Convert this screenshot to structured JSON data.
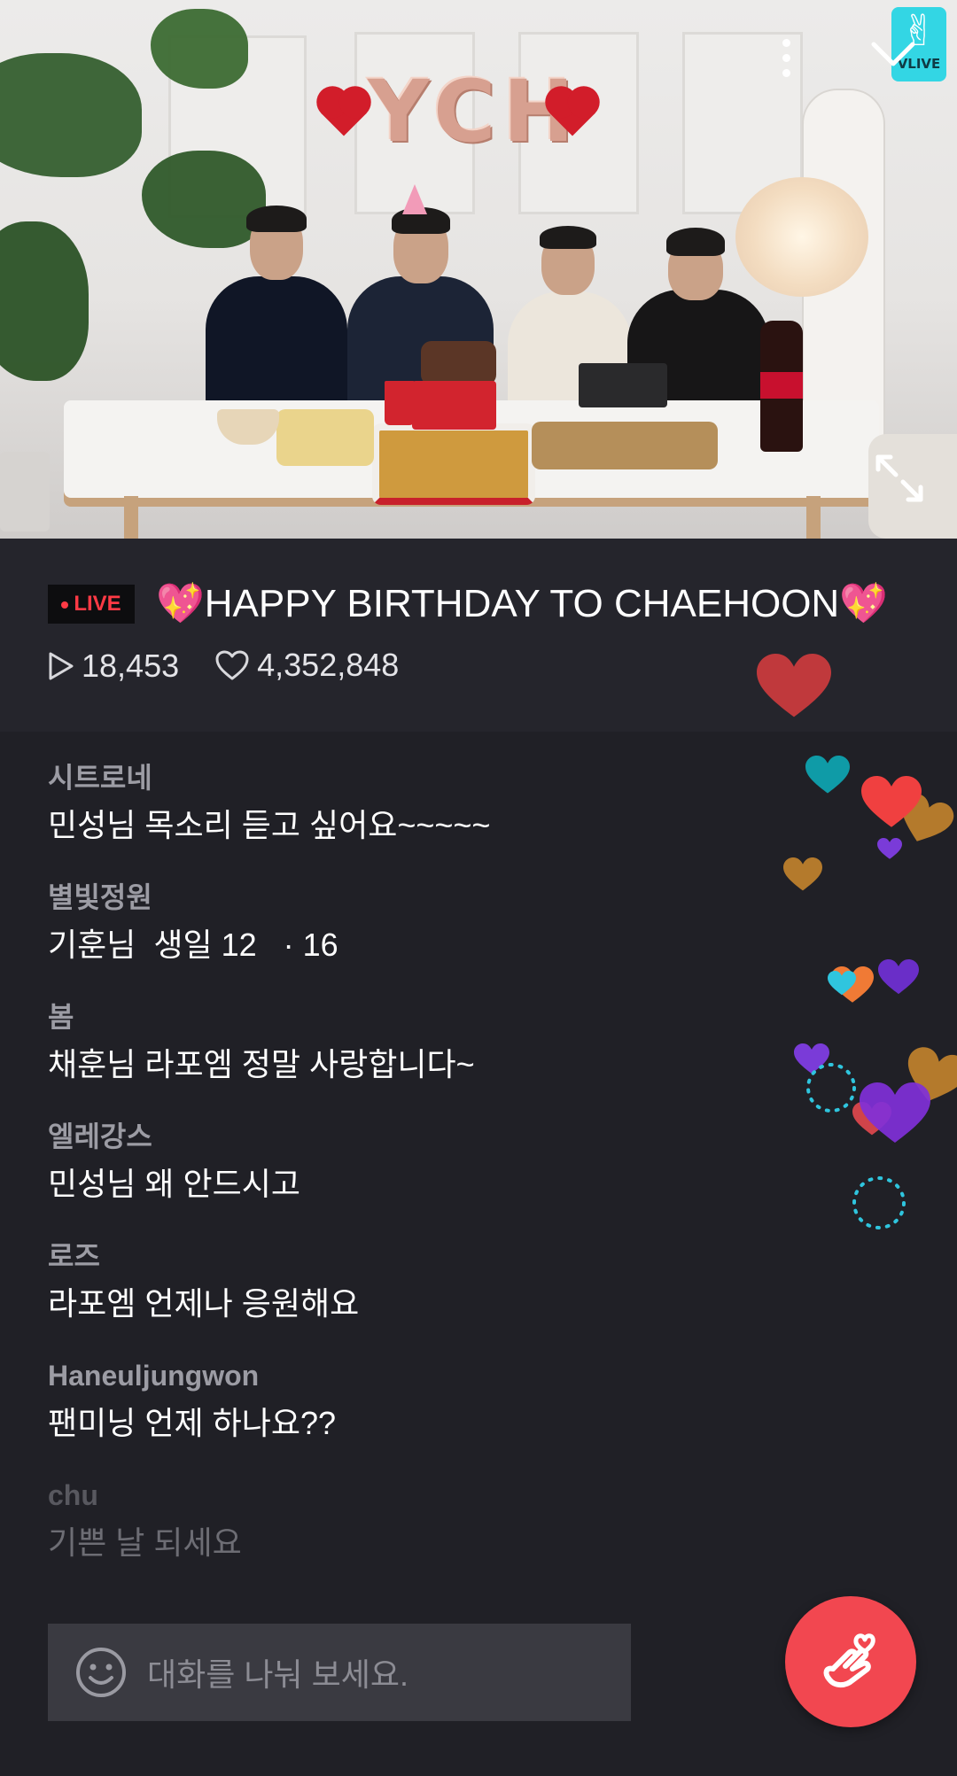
{
  "video": {
    "balloon_text": "YCH",
    "logo_text": "VLIVE",
    "icons": [
      "more-vertical-icon",
      "collapse-chevron-icon",
      "expand-fullscreen-icon"
    ]
  },
  "stream": {
    "live_badge": "LIVE",
    "title": "💖HAPPY BIRTHDAY TO CHAEHOON💖",
    "views": "18,453",
    "likes": "4,352,848"
  },
  "chat": [
    {
      "user": "시트로네",
      "text": "민성님 목소리 듣고 싶어요~~~~~"
    },
    {
      "user": "별빛정원",
      "text": "기훈님  생일 12   · 16"
    },
    {
      "user": "봄",
      "text": "채훈님 라포엠 정말 사랑합니다~"
    },
    {
      "user": "엘레강스",
      "text": "민성님 왜 안드시고"
    },
    {
      "user": "로즈",
      "text": "라포엠 언제나 응원해요"
    },
    {
      "user": "Haneuljungwon",
      "text": "팬미닝 언제 하나요??"
    },
    {
      "user": "chu",
      "text": "기쁜 날 되세요"
    }
  ],
  "input": {
    "placeholder": "대화를 나눠 보세요."
  },
  "colors": {
    "background": "#202026",
    "info_panel": "#25252c",
    "live_red": "#ff3a45",
    "button_red": "#f24750",
    "vlive_cyan": "#33d6e4"
  }
}
